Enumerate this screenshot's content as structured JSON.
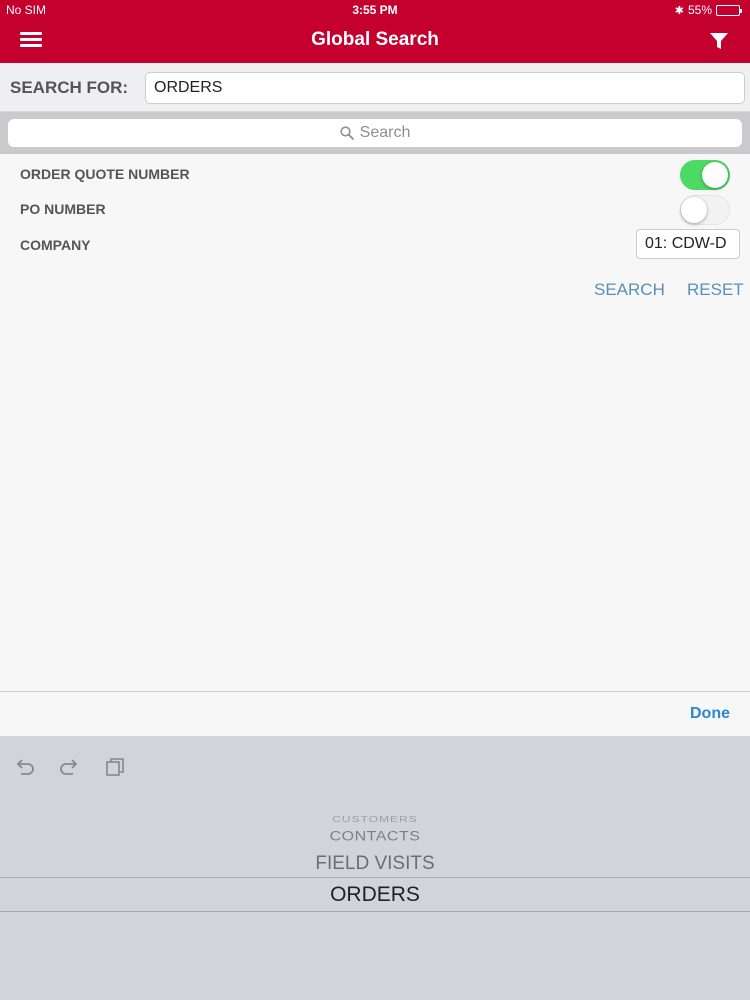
{
  "status_bar": {
    "carrier": "No SIM",
    "time": "3:55 PM",
    "battery_percent": "55%",
    "battery_level": 0.55
  },
  "nav": {
    "title": "Global Search",
    "menu_icon": "hamburger-menu-icon",
    "filter_icon": "filter-icon"
  },
  "search_for": {
    "label": "SEARCH FOR:",
    "value": "ORDERS"
  },
  "searchbar": {
    "placeholder": "Search",
    "icon": "search-icon"
  },
  "options": [
    {
      "label": "ORDER QUOTE NUMBER",
      "enabled": true
    },
    {
      "label": "PO NUMBER",
      "enabled": false
    }
  ],
  "company": {
    "label": "COMPANY",
    "value": "01: CDW-D"
  },
  "actions": {
    "search_label": "SEARCH",
    "reset_label": "RESET"
  },
  "toolbar": {
    "done_label": "Done"
  },
  "keyboard_shortcuts": [
    "undo-icon",
    "redo-icon",
    "paste-icon"
  ],
  "picker": {
    "items": [
      "CUSTOMERS",
      "CONTACTS",
      "FIELD VISITS",
      "ORDERS"
    ],
    "selected": "ORDERS"
  },
  "colors": {
    "brand": "#c4002e",
    "toggle_on": "#4cd964",
    "link": "#5a8fb8",
    "done": "#2d86d1"
  }
}
